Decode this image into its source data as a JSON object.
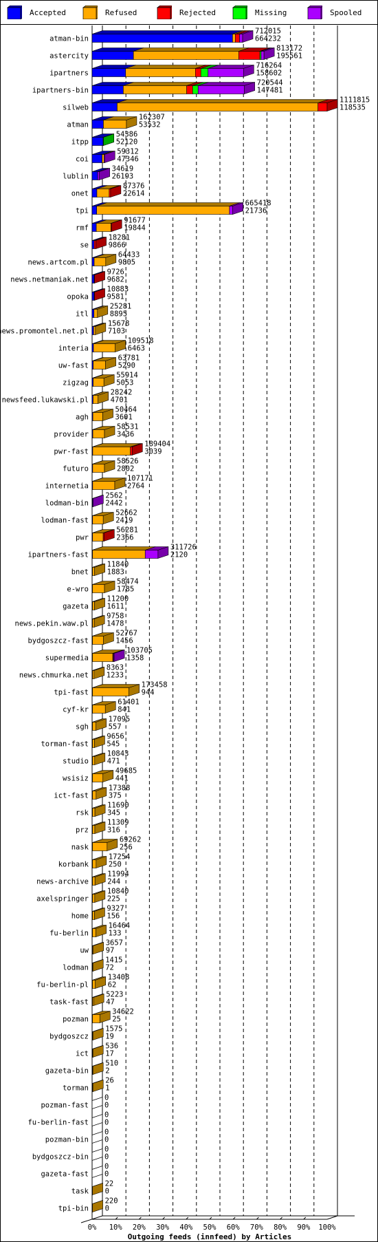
{
  "chart_data": {
    "type": "bar",
    "orientation": "horizontal",
    "stacked": true,
    "style": "3d",
    "title": "Outgoing feeds (innfeed) by Articles",
    "xlabel": "Outgoing feeds (innfeed) by Articles",
    "x_ticks": [
      "0%",
      "10%",
      "20%",
      "30%",
      "40%",
      "50%",
      "60%",
      "70%",
      "80%",
      "90%",
      "100%"
    ],
    "xlim": [
      0,
      100
    ],
    "scale_max": 1111815,
    "grid": true,
    "legend_position": "top",
    "legend": [
      {
        "name": "Accepted",
        "color": "#0000FF",
        "side": "#0000AA"
      },
      {
        "name": "Refused",
        "color": "#FFAA00",
        "side": "#AA7700"
      },
      {
        "name": "Rejected",
        "color": "#FF0000",
        "side": "#AA0000"
      },
      {
        "name": "Missing",
        "color": "#00FF00",
        "side": "#00AA00"
      },
      {
        "name": "Spooled",
        "color": "#AA00FF",
        "side": "#7700AA"
      }
    ],
    "series_order": [
      "Accepted",
      "Refused",
      "Rejected",
      "Missing",
      "Spooled"
    ],
    "rows": [
      {
        "name": "atman-bin",
        "total": 712015,
        "accepted": 664232,
        "segments": [
          664232,
          13000,
          20000,
          0,
          14783
        ]
      },
      {
        "name": "astercity",
        "total": 813172,
        "accepted": 195561,
        "segments": [
          195561,
          498000,
          100000,
          6000,
          13611
        ]
      },
      {
        "name": "ipartners",
        "total": 716264,
        "accepted": 158602,
        "segments": [
          158602,
          330000,
          26000,
          34000,
          167662
        ]
      },
      {
        "name": "ipartners-bin",
        "total": 720544,
        "accepted": 147481,
        "segments": [
          147481,
          300000,
          28000,
          26000,
          219063
        ]
      },
      {
        "name": "silweb",
        "total": 1111815,
        "accepted": 118535,
        "segments": [
          118535,
          950000,
          43280,
          0,
          0
        ]
      },
      {
        "name": "atman",
        "total": 162307,
        "accepted": 53532,
        "segments": [
          53532,
          108775,
          0,
          0,
          0
        ]
      },
      {
        "name": "itpp",
        "total": 54386,
        "accepted": 52120,
        "segments": [
          52120,
          0,
          0,
          2266,
          0
        ]
      },
      {
        "name": "coi",
        "total": 59312,
        "accepted": 47346,
        "segments": [
          47346,
          9000,
          0,
          0,
          2966
        ]
      },
      {
        "name": "lublin",
        "total": 34619,
        "accepted": 26193,
        "segments": [
          26193,
          0,
          0,
          0,
          8426
        ]
      },
      {
        "name": "onet",
        "total": 87376,
        "accepted": 22614,
        "segments": [
          22614,
          58000,
          6762,
          0,
          0
        ]
      },
      {
        "name": "tpi",
        "total": 665418,
        "accepted": 21736,
        "segments": [
          21736,
          628000,
          0,
          0,
          15682
        ]
      },
      {
        "name": "rmf",
        "total": 91677,
        "accepted": 19844,
        "segments": [
          19844,
          69000,
          2833,
          0,
          0
        ]
      },
      {
        "name": "se",
        "total": 18281,
        "accepted": 9866,
        "segments": [
          9866,
          0,
          8415,
          0,
          0
        ]
      },
      {
        "name": "news.artcom.pl",
        "total": 64433,
        "accepted": 9805,
        "segments": [
          9805,
          54628,
          0,
          0,
          0
        ]
      },
      {
        "name": "news.netmaniak.net",
        "total": 9726,
        "accepted": 9682,
        "segments": [
          9682,
          0,
          44,
          0,
          0
        ]
      },
      {
        "name": "opoka",
        "total": 10883,
        "accepted": 9581,
        "segments": [
          9581,
          0,
          1302,
          0,
          0
        ]
      },
      {
        "name": "itl",
        "total": 25281,
        "accepted": 8895,
        "segments": [
          8895,
          16386,
          0,
          0,
          0
        ]
      },
      {
        "name": "news.promontel.net.pl",
        "total": 15678,
        "accepted": 7103,
        "segments": [
          7103,
          8575,
          0,
          0,
          0
        ]
      },
      {
        "name": "interia",
        "total": 109518,
        "accepted": 6463,
        "segments": [
          6463,
          103055,
          0,
          0,
          0
        ]
      },
      {
        "name": "uw-fast",
        "total": 63781,
        "accepted": 5290,
        "segments": [
          5290,
          58491,
          0,
          0,
          0
        ]
      },
      {
        "name": "zigzag",
        "total": 55914,
        "accepted": 5053,
        "segments": [
          5053,
          50861,
          0,
          0,
          0
        ]
      },
      {
        "name": "newsfeed.lukawski.pl",
        "total": 28242,
        "accepted": 4701,
        "segments": [
          4701,
          23541,
          0,
          0,
          0
        ]
      },
      {
        "name": "agh",
        "total": 50464,
        "accepted": 3601,
        "segments": [
          3601,
          46863,
          0,
          0,
          0
        ]
      },
      {
        "name": "provider",
        "total": 58531,
        "accepted": 3436,
        "segments": [
          3436,
          55095,
          0,
          0,
          0
        ]
      },
      {
        "name": "pwr-fast",
        "total": 189404,
        "accepted": 3039,
        "segments": [
          3039,
          178000,
          8365,
          0,
          0
        ]
      },
      {
        "name": "futuro",
        "total": 58526,
        "accepted": 2802,
        "segments": [
          2802,
          55724,
          0,
          0,
          0
        ]
      },
      {
        "name": "internetia",
        "total": 107171,
        "accepted": 2764,
        "segments": [
          2764,
          104407,
          0,
          0,
          0
        ]
      },
      {
        "name": "lodman-bin",
        "total": 2562,
        "accepted": 2442,
        "segments": [
          2442,
          0,
          0,
          0,
          120
        ]
      },
      {
        "name": "lodman-fast",
        "total": 52662,
        "accepted": 2419,
        "segments": [
          2419,
          50243,
          0,
          0,
          0
        ]
      },
      {
        "name": "pwr",
        "total": 56281,
        "accepted": 2366,
        "segments": [
          2366,
          50000,
          3915,
          0,
          0
        ]
      },
      {
        "name": "ipartners-fast",
        "total": 311726,
        "accepted": 2120,
        "segments": [
          2120,
          249000,
          0,
          0,
          60606
        ]
      },
      {
        "name": "bnet",
        "total": 11840,
        "accepted": 1883,
        "segments": [
          1883,
          9957,
          0,
          0,
          0
        ]
      },
      {
        "name": "e-wro",
        "total": 58474,
        "accepted": 1785,
        "segments": [
          1785,
          56689,
          0,
          0,
          0
        ]
      },
      {
        "name": "gazeta",
        "total": 11200,
        "accepted": 1611,
        "segments": [
          1611,
          9589,
          0,
          0,
          0
        ]
      },
      {
        "name": "news.pekin.waw.pl",
        "total": 9758,
        "accepted": 1478,
        "segments": [
          1478,
          8280,
          0,
          0,
          0
        ]
      },
      {
        "name": "bydgoszcz-fast",
        "total": 52767,
        "accepted": 1456,
        "segments": [
          1456,
          51311,
          0,
          0,
          0
        ]
      },
      {
        "name": "supermedia",
        "total": 103705,
        "accepted": 1358,
        "segments": [
          1358,
          96000,
          3000,
          0,
          3347
        ]
      },
      {
        "name": "news.chmurka.net",
        "total": 8363,
        "accepted": 1233,
        "segments": [
          1233,
          7130,
          0,
          0,
          0
        ]
      },
      {
        "name": "tpi-fast",
        "total": 173458,
        "accepted": 944,
        "segments": [
          944,
          172514,
          0,
          0,
          0
        ]
      },
      {
        "name": "cyf-kr",
        "total": 61401,
        "accepted": 841,
        "segments": [
          841,
          60560,
          0,
          0,
          0
        ]
      },
      {
        "name": "sgh",
        "total": 17095,
        "accepted": 557,
        "segments": [
          557,
          16538,
          0,
          0,
          0
        ]
      },
      {
        "name": "torman-fast",
        "total": 9656,
        "accepted": 545,
        "segments": [
          545,
          9111,
          0,
          0,
          0
        ]
      },
      {
        "name": "studio",
        "total": 10843,
        "accepted": 471,
        "segments": [
          471,
          10372,
          0,
          0,
          0
        ]
      },
      {
        "name": "wsisiz",
        "total": 49685,
        "accepted": 441,
        "segments": [
          441,
          49244,
          0,
          0,
          0
        ]
      },
      {
        "name": "ict-fast",
        "total": 17388,
        "accepted": 375,
        "segments": [
          375,
          17013,
          0,
          0,
          0
        ]
      },
      {
        "name": "rsk",
        "total": 11690,
        "accepted": 345,
        "segments": [
          345,
          11345,
          0,
          0,
          0
        ]
      },
      {
        "name": "prz",
        "total": 11309,
        "accepted": 316,
        "segments": [
          316,
          10993,
          0,
          0,
          0
        ]
      },
      {
        "name": "nask",
        "total": 69262,
        "accepted": 256,
        "segments": [
          256,
          69006,
          0,
          0,
          0
        ]
      },
      {
        "name": "korbank",
        "total": 17254,
        "accepted": 250,
        "segments": [
          250,
          17004,
          0,
          0,
          0
        ]
      },
      {
        "name": "news-archive",
        "total": 11994,
        "accepted": 244,
        "segments": [
          244,
          11750,
          0,
          0,
          0
        ]
      },
      {
        "name": "axelspringer",
        "total": 10840,
        "accepted": 225,
        "segments": [
          225,
          10615,
          0,
          0,
          0
        ]
      },
      {
        "name": "home",
        "total": 9327,
        "accepted": 156,
        "segments": [
          156,
          9171,
          0,
          0,
          0
        ]
      },
      {
        "name": "fu-berlin",
        "total": 16464,
        "accepted": 133,
        "segments": [
          133,
          16331,
          0,
          0,
          0
        ]
      },
      {
        "name": "uw",
        "total": 3657,
        "accepted": 97,
        "segments": [
          97,
          3560,
          0,
          0,
          0
        ]
      },
      {
        "name": "lodman",
        "total": 1415,
        "accepted": 72,
        "segments": [
          72,
          1343,
          0,
          0,
          0
        ]
      },
      {
        "name": "fu-berlin-pl",
        "total": 13408,
        "accepted": 62,
        "segments": [
          62,
          13346,
          0,
          0,
          0
        ]
      },
      {
        "name": "task-fast",
        "total": 5223,
        "accepted": 47,
        "segments": [
          47,
          5176,
          0,
          0,
          0
        ]
      },
      {
        "name": "pozman",
        "total": 34622,
        "accepted": 25,
        "segments": [
          25,
          34597,
          0,
          0,
          0
        ]
      },
      {
        "name": "bydgoszcz",
        "total": 1575,
        "accepted": 19,
        "segments": [
          19,
          1556,
          0,
          0,
          0
        ]
      },
      {
        "name": "ict",
        "total": 536,
        "accepted": 17,
        "segments": [
          17,
          519,
          0,
          0,
          0
        ]
      },
      {
        "name": "gazeta-bin",
        "total": 510,
        "accepted": 2,
        "segments": [
          2,
          508,
          0,
          0,
          0
        ]
      },
      {
        "name": "torman",
        "total": 26,
        "accepted": 1,
        "segments": [
          1,
          25,
          0,
          0,
          0
        ]
      },
      {
        "name": "pozman-fast",
        "total": 0,
        "accepted": 0,
        "segments": [
          0,
          0,
          0,
          0,
          0
        ]
      },
      {
        "name": "fu-berlin-fast",
        "total": 0,
        "accepted": 0,
        "segments": [
          0,
          0,
          0,
          0,
          0
        ]
      },
      {
        "name": "pozman-bin",
        "total": 0,
        "accepted": 0,
        "segments": [
          0,
          0,
          0,
          0,
          0
        ]
      },
      {
        "name": "bydgoszcz-bin",
        "total": 0,
        "accepted": 0,
        "segments": [
          0,
          0,
          0,
          0,
          0
        ]
      },
      {
        "name": "gazeta-fast",
        "total": 0,
        "accepted": 0,
        "segments": [
          0,
          0,
          0,
          0,
          0
        ]
      },
      {
        "name": "task",
        "total": 22,
        "accepted": 0,
        "segments": [
          0,
          22,
          0,
          0,
          0
        ]
      },
      {
        "name": "tpi-bin",
        "total": 220,
        "accepted": 0,
        "segments": [
          0,
          220,
          0,
          0,
          0
        ]
      }
    ]
  }
}
